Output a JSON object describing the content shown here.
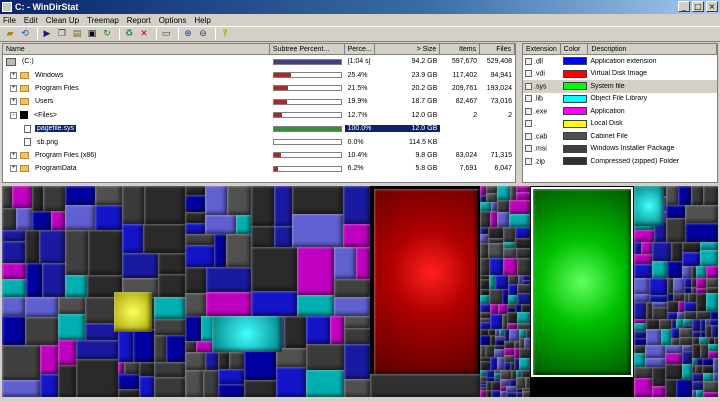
{
  "window": {
    "title": "C: - WinDirStat",
    "buttons": {
      "minimize": "_",
      "maximize": "□",
      "close": "×"
    }
  },
  "menu": [
    "File",
    "Edit",
    "Clean Up",
    "Treemap",
    "Report",
    "Options",
    "Help"
  ],
  "toolbar": [
    "open-icon",
    "refresh-icon",
    "play-icon",
    "copy-icon",
    "explorer-icon",
    "cmd-icon",
    "refresh-all-icon",
    "recycle-icon",
    "delete-icon",
    "folder-icon",
    "zoom-in-icon",
    "zoom-out-icon",
    "help-icon"
  ],
  "dirlist": {
    "headers": {
      "name": "Name",
      "subtree": "Subtree Percent...",
      "percent": "Perce...",
      "size": "> Size",
      "items": "Items",
      "files": "Files"
    },
    "rows": [
      {
        "name": "(C:)",
        "expander": "",
        "icon": "drive",
        "bar": 1.0,
        "percent": "[1:04 s]",
        "size": "94.2 GB",
        "items": "597,670",
        "files": "529,408",
        "selected": false,
        "bar_color": "#404080"
      },
      {
        "name": "Windows",
        "expander": "+",
        "icon": "folder",
        "bar": 0.254,
        "percent": "25.4%",
        "size": "23.9 GB",
        "items": "117,402",
        "files": "94,941",
        "selected": false,
        "bar_color": "#a52a2a"
      },
      {
        "name": "Program Files",
        "expander": "+",
        "icon": "folder",
        "bar": 0.215,
        "percent": "21.5%",
        "size": "20.2 GB",
        "items": "209,761",
        "files": "193,024",
        "selected": false,
        "bar_color": "#a52a2a"
      },
      {
        "name": "Users",
        "expander": "+",
        "icon": "folder",
        "bar": 0.199,
        "percent": "19.9%",
        "size": "18.7 GB",
        "items": "82,467",
        "files": "73,016",
        "selected": false,
        "bar_color": "#a52a2a"
      },
      {
        "name": "<Files>",
        "expander": "-",
        "icon": "files",
        "bar": 0.127,
        "percent": "12.7%",
        "size": "12.0 GB",
        "items": "2",
        "files": "2",
        "selected": false,
        "bar_color": "#a52a2a"
      },
      {
        "name": "pagefile.sys",
        "expander": "",
        "icon": "file",
        "bar": 1.0,
        "percent": "100.0%",
        "size": "12.0 GB",
        "items": "",
        "files": "",
        "selected": true,
        "bar_color": "#3c8c3c"
      },
      {
        "name": "sb.png",
        "expander": "",
        "icon": "file",
        "bar": 0.0,
        "percent": "0.0%",
        "size": "114.5 KB",
        "items": "",
        "files": "",
        "selected": false,
        "bar_color": "#a52a2a"
      },
      {
        "name": "Program Files (x86)",
        "expander": "+",
        "icon": "folder",
        "bar": 0.104,
        "percent": "10.4%",
        "size": "9.8 GB",
        "items": "83,024",
        "files": "71,315",
        "selected": false,
        "bar_color": "#a52a2a"
      },
      {
        "name": "ProgramData",
        "expander": "+",
        "icon": "folder",
        "bar": 0.062,
        "percent": "6.2%",
        "size": "5.8 GB",
        "items": "7,691",
        "files": "6,047",
        "selected": false,
        "bar_color": "#a52a2a"
      }
    ]
  },
  "extlist": {
    "headers": {
      "ext": "Extension",
      "color": "Color",
      "desc": "Description"
    },
    "rows": [
      {
        "ext": ".dll",
        "color": "#0000ff",
        "desc": "Application extension",
        "highlight": false
      },
      {
        "ext": ".vdi",
        "color": "#ff0000",
        "desc": "Virtual Disk Image",
        "highlight": false
      },
      {
        "ext": ".sys",
        "color": "#00ff00",
        "desc": "System file",
        "highlight": true
      },
      {
        "ext": ".lib",
        "color": "#00ffff",
        "desc": "Object File Library",
        "highlight": false
      },
      {
        "ext": ".exe",
        "color": "#ff00ff",
        "desc": "Application",
        "highlight": false
      },
      {
        "ext": ".",
        "color": "#ffff00",
        "desc": "Local Disk",
        "highlight": false
      },
      {
        "ext": ".cab",
        "color": "#505050",
        "desc": "Cabinet File",
        "highlight": false
      },
      {
        "ext": ".msi",
        "color": "#404040",
        "desc": "Windows Installer Package",
        "highlight": false
      },
      {
        "ext": ".zip",
        "color": "#303030",
        "desc": "Compressed (zipped) Folder",
        "highlight": false
      }
    ]
  },
  "treemap": {
    "selected_file": "pagefile.sys"
  }
}
